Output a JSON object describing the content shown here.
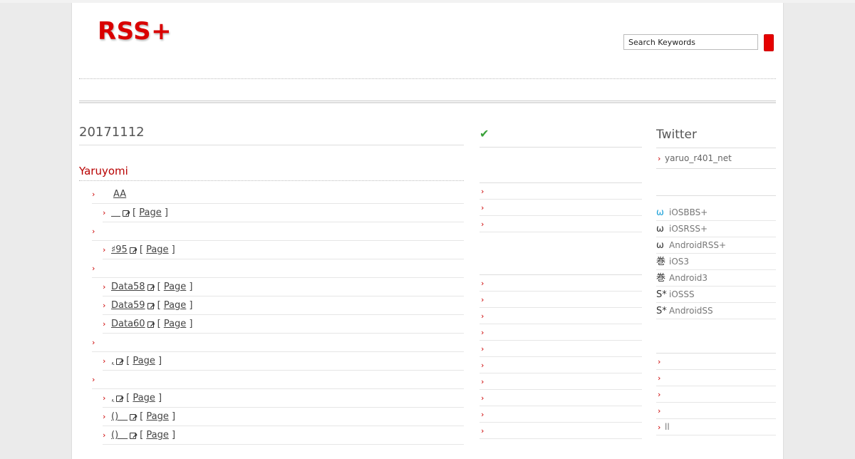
{
  "header": {
    "logo": "RSS+",
    "search_value": "Search Keywords"
  },
  "main": {
    "date": "20171112",
    "section": "Yaruyomi",
    "page_label": "Page",
    "rows": [
      {
        "type": "cat",
        "text": "AA"
      },
      {
        "type": "item",
        "text": "＿"
      },
      {
        "type": "cat",
        "text": ""
      },
      {
        "type": "item",
        "text": "♯95"
      },
      {
        "type": "cat",
        "text": ""
      },
      {
        "type": "item",
        "text": "Data58"
      },
      {
        "type": "item",
        "text": "Data59"
      },
      {
        "type": "item",
        "text": "Data60"
      },
      {
        "type": "cat",
        "text": ""
      },
      {
        "type": "item",
        "text": ","
      },
      {
        "type": "cat",
        "text": ""
      },
      {
        "type": "item",
        "text": ","
      },
      {
        "type": "item",
        "text": "()＿"
      },
      {
        "type": "item",
        "text": "()＿"
      }
    ]
  },
  "middle": {
    "check_icon": "check-icon",
    "check_color": "#3aa23a",
    "group1_count": 3,
    "group2_count": 10
  },
  "right": {
    "twitter_title": "Twitter",
    "twitter_handle": "yaruo_r401_net",
    "apps": [
      {
        "glyph": "ω",
        "icon": "omega-icon",
        "blue": true,
        "label": "iOSBBS+"
      },
      {
        "glyph": "ω",
        "icon": "omega-icon",
        "blue": false,
        "label": "iOSRSS+"
      },
      {
        "glyph": "ω",
        "icon": "omega-icon",
        "blue": false,
        "label": "AndroidRSS+"
      },
      {
        "glyph": "巻",
        "icon": "scroll-kanji-icon",
        "blue": false,
        "label": "iOS3"
      },
      {
        "glyph": "巻",
        "icon": "scroll-kanji-icon",
        "blue": false,
        "label": "Android3"
      },
      {
        "glyph": "S*",
        "icon": "s-star-icon",
        "blue": false,
        "label": "iOSSS"
      },
      {
        "glyph": "S*",
        "icon": "s-star-icon",
        "blue": false,
        "label": "AndroidSS"
      }
    ],
    "links": [
      "",
      "",
      "",
      "",
      "ll"
    ]
  }
}
